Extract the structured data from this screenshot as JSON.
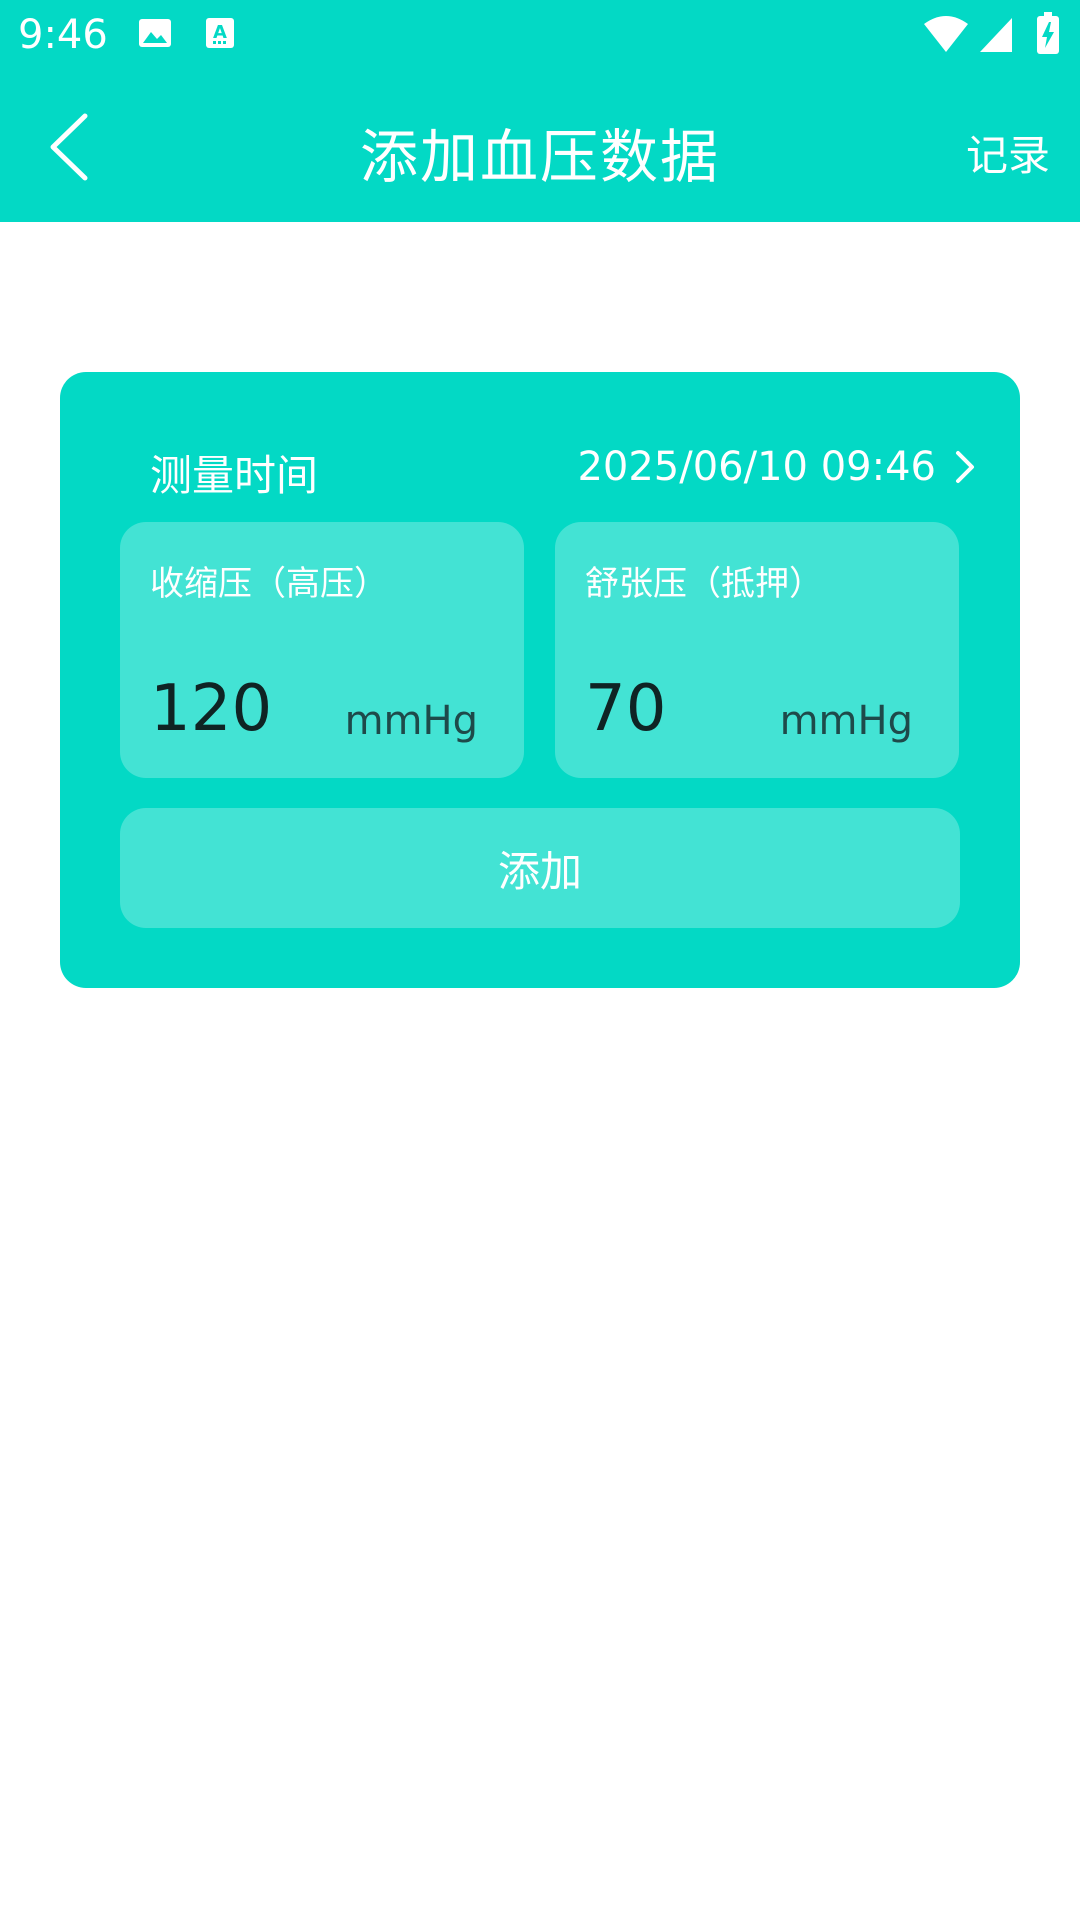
{
  "status_bar": {
    "time": "9:46",
    "icons": [
      "image-icon",
      "font-a-icon",
      "wifi-icon",
      "signal-icon",
      "battery-charging-icon"
    ]
  },
  "nav": {
    "title": "添加血压数据",
    "right_label": "记录",
    "back_icon": "back-arrow-icon"
  },
  "card": {
    "time_label": "测量时间",
    "time_value": "2025/06/10 09:46",
    "systolic": {
      "label": "收缩压（高压）",
      "value": "120",
      "unit": "mmHg"
    },
    "diastolic": {
      "label": "舒张压（抵押）",
      "value": "70",
      "unit": "mmHg"
    },
    "add_label": "添加"
  },
  "colors": {
    "primary": "#03D9C5",
    "input_bg": "#43E3D4",
    "white": "#FFFFFF",
    "value_text": "#0F2424"
  }
}
